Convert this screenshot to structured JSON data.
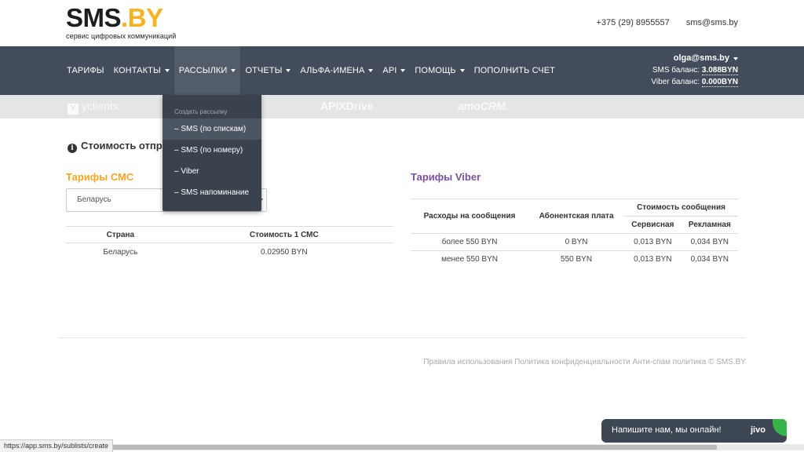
{
  "header": {
    "logo_main": "SMS",
    "logo_accent": ".BY",
    "logo_sub": "сервис цифровых коммуникаций",
    "phone": "+375 (29) 8955557",
    "email": "sms@sms.by"
  },
  "nav": {
    "items": [
      {
        "label": "Тарифы"
      },
      {
        "label": "Контакты"
      },
      {
        "label": "Рассылки"
      },
      {
        "label": "Отчеты"
      },
      {
        "label": "Альфа-имена"
      },
      {
        "label": "API"
      },
      {
        "label": "Помощь"
      },
      {
        "label": "Пополнить счет"
      }
    ]
  },
  "account": {
    "user": "olga@sms.by",
    "sms_label": "SMS баланс:",
    "sms_value": "3.088BYN",
    "viber_label": "Viber баланс:",
    "viber_value": "0.000BYN"
  },
  "partners": {
    "p1": "yclients",
    "p2": "APIXDrive",
    "p3": "amoCRM."
  },
  "dropdown": {
    "header": "Создать рассылку",
    "items": [
      {
        "label": "– SMS (по спискам)"
      },
      {
        "label": "– SMS (по номеру)"
      },
      {
        "label": "– Viber"
      },
      {
        "label": "– SMS напоминание"
      }
    ]
  },
  "main": {
    "section_title": "Стоимость отправки",
    "sms_title": "Тарифы СМС",
    "viber_title": "Тарифы Viber",
    "country_select": "Беларусь",
    "sms_table": {
      "col1": "Страна",
      "col2": "Стоимость 1 СМС",
      "rows": [
        {
          "country": "Беларусь",
          "price": "0.02950 BYN"
        }
      ]
    },
    "viber_table": {
      "col_spend": "Расходы на сообщения",
      "col_fee": "Абонентская плата",
      "col_cost": "Стоимость сообщения",
      "col_service": "Сервисная",
      "col_ad": "Рекламная",
      "rows": [
        {
          "spend": "более 550 BYN",
          "fee": "0 BYN",
          "service": "0,013 BYN",
          "ad": "0,034 BYN"
        },
        {
          "spend": "менее 550 BYN",
          "fee": "550 BYN",
          "service": "0,013 BYN",
          "ad": "0,034 BYN"
        }
      ]
    }
  },
  "footer": {
    "rules": "Правила использования",
    "privacy": "Политика конфиденциальности",
    "antispam": "Анти-спам политика",
    "copyright": "© SMS.BY"
  },
  "statusbar": {
    "url": "https://app.sms.by/sublists/create"
  },
  "chat": {
    "text": "Напишите нам, мы онлайн!",
    "brand": "jivo"
  }
}
